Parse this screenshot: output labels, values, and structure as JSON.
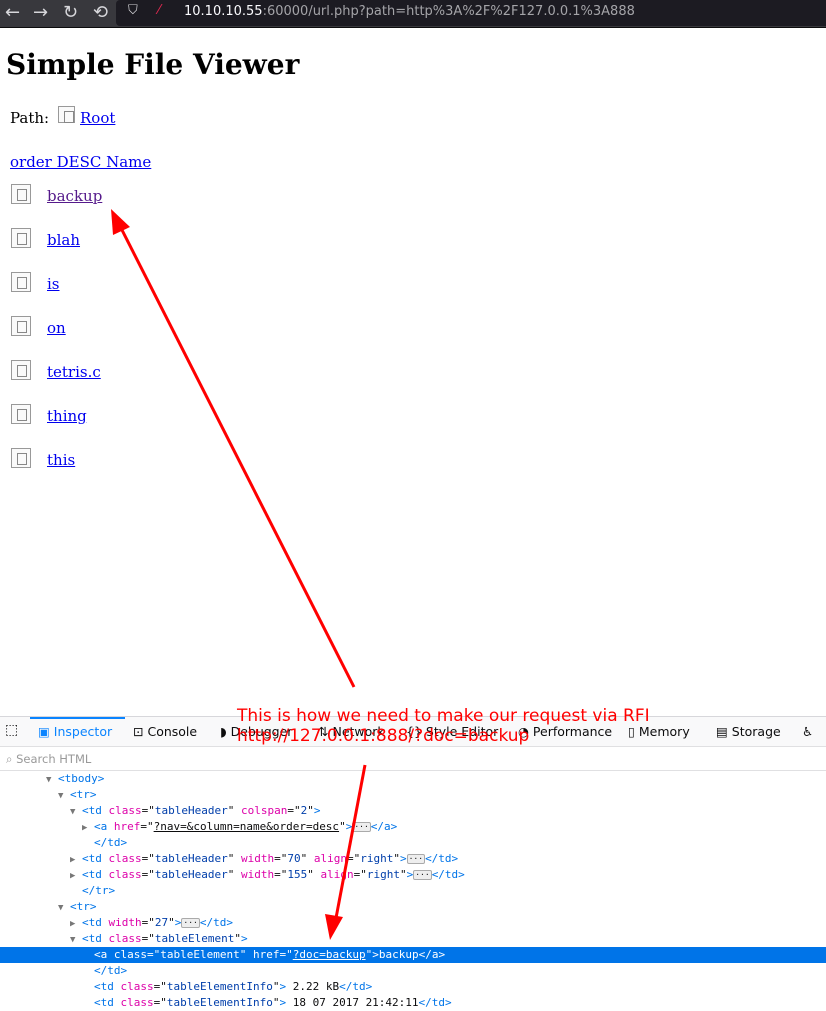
{
  "browser": {
    "url_host": "10.10.10.55",
    "url_rest": ":60000/url.php?path=http%3A%2F%2F127.0.0.1%3A888"
  },
  "page": {
    "title": "Simple File Viewer",
    "path_label": "Path:",
    "root_link": "Root",
    "sort_link": "order DESC  Name",
    "files": [
      "backup",
      "blah",
      "is",
      "on",
      "tetris.c",
      "thing",
      "this"
    ]
  },
  "annotation": {
    "line1": "This is how we need to make our request via RFI",
    "line2": "http://127.0.0.1:888/?doc=backup",
    "color": "#ff0000"
  },
  "devtools": {
    "tabs": [
      "Inspector",
      "Console",
      "Debugger",
      "Network",
      "Style Editor",
      "Performance",
      "Memory",
      "Storage"
    ],
    "search_placeholder": "Search HTML",
    "tree": [
      {
        "d": 3,
        "tw": "▼",
        "t": [
          [
            "tag",
            "<tbody>"
          ]
        ]
      },
      {
        "d": 4,
        "tw": "▼",
        "t": [
          [
            "tag",
            "<tr>"
          ]
        ]
      },
      {
        "d": 5,
        "tw": "▼",
        "t": [
          [
            "tag",
            "<td "
          ],
          [
            "an",
            "class"
          ],
          [
            "",
            "=\""
          ],
          [
            "av",
            "tableHeader"
          ],
          [
            "",
            "\" "
          ],
          [
            "an",
            "colspan"
          ],
          [
            "",
            "=\""
          ],
          [
            "av",
            "2"
          ],
          [
            "",
            "\""
          ],
          [
            "tag",
            ">"
          ]
        ]
      },
      {
        "d": 6,
        "tw": "▶",
        "t": [
          [
            "tag",
            "<a "
          ],
          [
            "an",
            "href"
          ],
          [
            "",
            "=\""
          ],
          [
            "lk",
            "?nav=&column=name&order=desc"
          ],
          [
            "",
            "\""
          ],
          [
            "tag",
            ">"
          ],
          [
            "dots",
            "···"
          ],
          [
            "tag",
            "</a>"
          ]
        ]
      },
      {
        "d": 6,
        "tw": "",
        "t": [
          [
            "tag",
            "</td>"
          ]
        ]
      },
      {
        "d": 5,
        "tw": "▶",
        "t": [
          [
            "tag",
            "<td "
          ],
          [
            "an",
            "class"
          ],
          [
            "",
            "=\""
          ],
          [
            "av",
            "tableHeader"
          ],
          [
            "",
            "\" "
          ],
          [
            "an",
            "width"
          ],
          [
            "",
            "=\""
          ],
          [
            "av",
            "70"
          ],
          [
            "",
            "\" "
          ],
          [
            "an",
            "align"
          ],
          [
            "",
            "=\""
          ],
          [
            "av",
            "right"
          ],
          [
            "",
            "\""
          ],
          [
            "tag",
            ">"
          ],
          [
            "dots",
            "···"
          ],
          [
            "tag",
            "</td>"
          ]
        ]
      },
      {
        "d": 5,
        "tw": "▶",
        "t": [
          [
            "tag",
            "<td "
          ],
          [
            "an",
            "class"
          ],
          [
            "",
            "=\""
          ],
          [
            "av",
            "tableHeader"
          ],
          [
            "",
            "\" "
          ],
          [
            "an",
            "width"
          ],
          [
            "",
            "=\""
          ],
          [
            "av",
            "155"
          ],
          [
            "",
            "\" "
          ],
          [
            "an",
            "align"
          ],
          [
            "",
            "=\""
          ],
          [
            "av",
            "right"
          ],
          [
            "",
            "\""
          ],
          [
            "tag",
            ">"
          ],
          [
            "dots",
            "···"
          ],
          [
            "tag",
            "</td>"
          ]
        ]
      },
      {
        "d": 5,
        "tw": "",
        "t": [
          [
            "tag",
            "</tr>"
          ]
        ]
      },
      {
        "d": 4,
        "tw": "▼",
        "t": [
          [
            "tag",
            "<tr>"
          ]
        ]
      },
      {
        "d": 5,
        "tw": "▶",
        "t": [
          [
            "tag",
            "<td "
          ],
          [
            "an",
            "width"
          ],
          [
            "",
            "=\""
          ],
          [
            "av",
            "27"
          ],
          [
            "",
            "\""
          ],
          [
            "tag",
            ">"
          ],
          [
            "dots",
            "···"
          ],
          [
            "tag",
            "</td>"
          ]
        ]
      },
      {
        "d": 5,
        "tw": "▼",
        "t": [
          [
            "tag",
            "<td "
          ],
          [
            "an",
            "class"
          ],
          [
            "",
            "=\""
          ],
          [
            "av",
            "tableElement"
          ],
          [
            "",
            "\""
          ],
          [
            "tag",
            ">"
          ]
        ]
      },
      {
        "d": 6,
        "tw": "",
        "sel": true,
        "t": [
          [
            "tag",
            "<a "
          ],
          [
            "an",
            "class"
          ],
          [
            "",
            "=\""
          ],
          [
            "av",
            "tableElement"
          ],
          [
            "",
            "\" "
          ],
          [
            "an",
            "href"
          ],
          [
            "",
            "=\""
          ],
          [
            "lk",
            "?doc=backup"
          ],
          [
            "",
            "\""
          ],
          [
            "tag",
            ">"
          ],
          [
            "",
            "backup"
          ],
          [
            "tag",
            "</a>"
          ]
        ]
      },
      {
        "d": 6,
        "tw": "",
        "t": [
          [
            "tag",
            "</td>"
          ]
        ]
      },
      {
        "d": 6,
        "tw": "",
        "t": [
          [
            "tag",
            "<td "
          ],
          [
            "an",
            "class"
          ],
          [
            "",
            "=\""
          ],
          [
            "av",
            "tableElementInfo"
          ],
          [
            "",
            "\""
          ],
          [
            "tag",
            ">"
          ],
          [
            "",
            " 2.22 kB"
          ],
          [
            "tag",
            "</td>"
          ]
        ]
      },
      {
        "d": 6,
        "tw": "",
        "t": [
          [
            "tag",
            "<td "
          ],
          [
            "an",
            "class"
          ],
          [
            "",
            "=\""
          ],
          [
            "av",
            "tableElementInfo"
          ],
          [
            "",
            "\""
          ],
          [
            "tag",
            ">"
          ],
          [
            "",
            " 18 07 2017 21:42:11"
          ],
          [
            "tag",
            "</td>"
          ]
        ]
      }
    ]
  }
}
